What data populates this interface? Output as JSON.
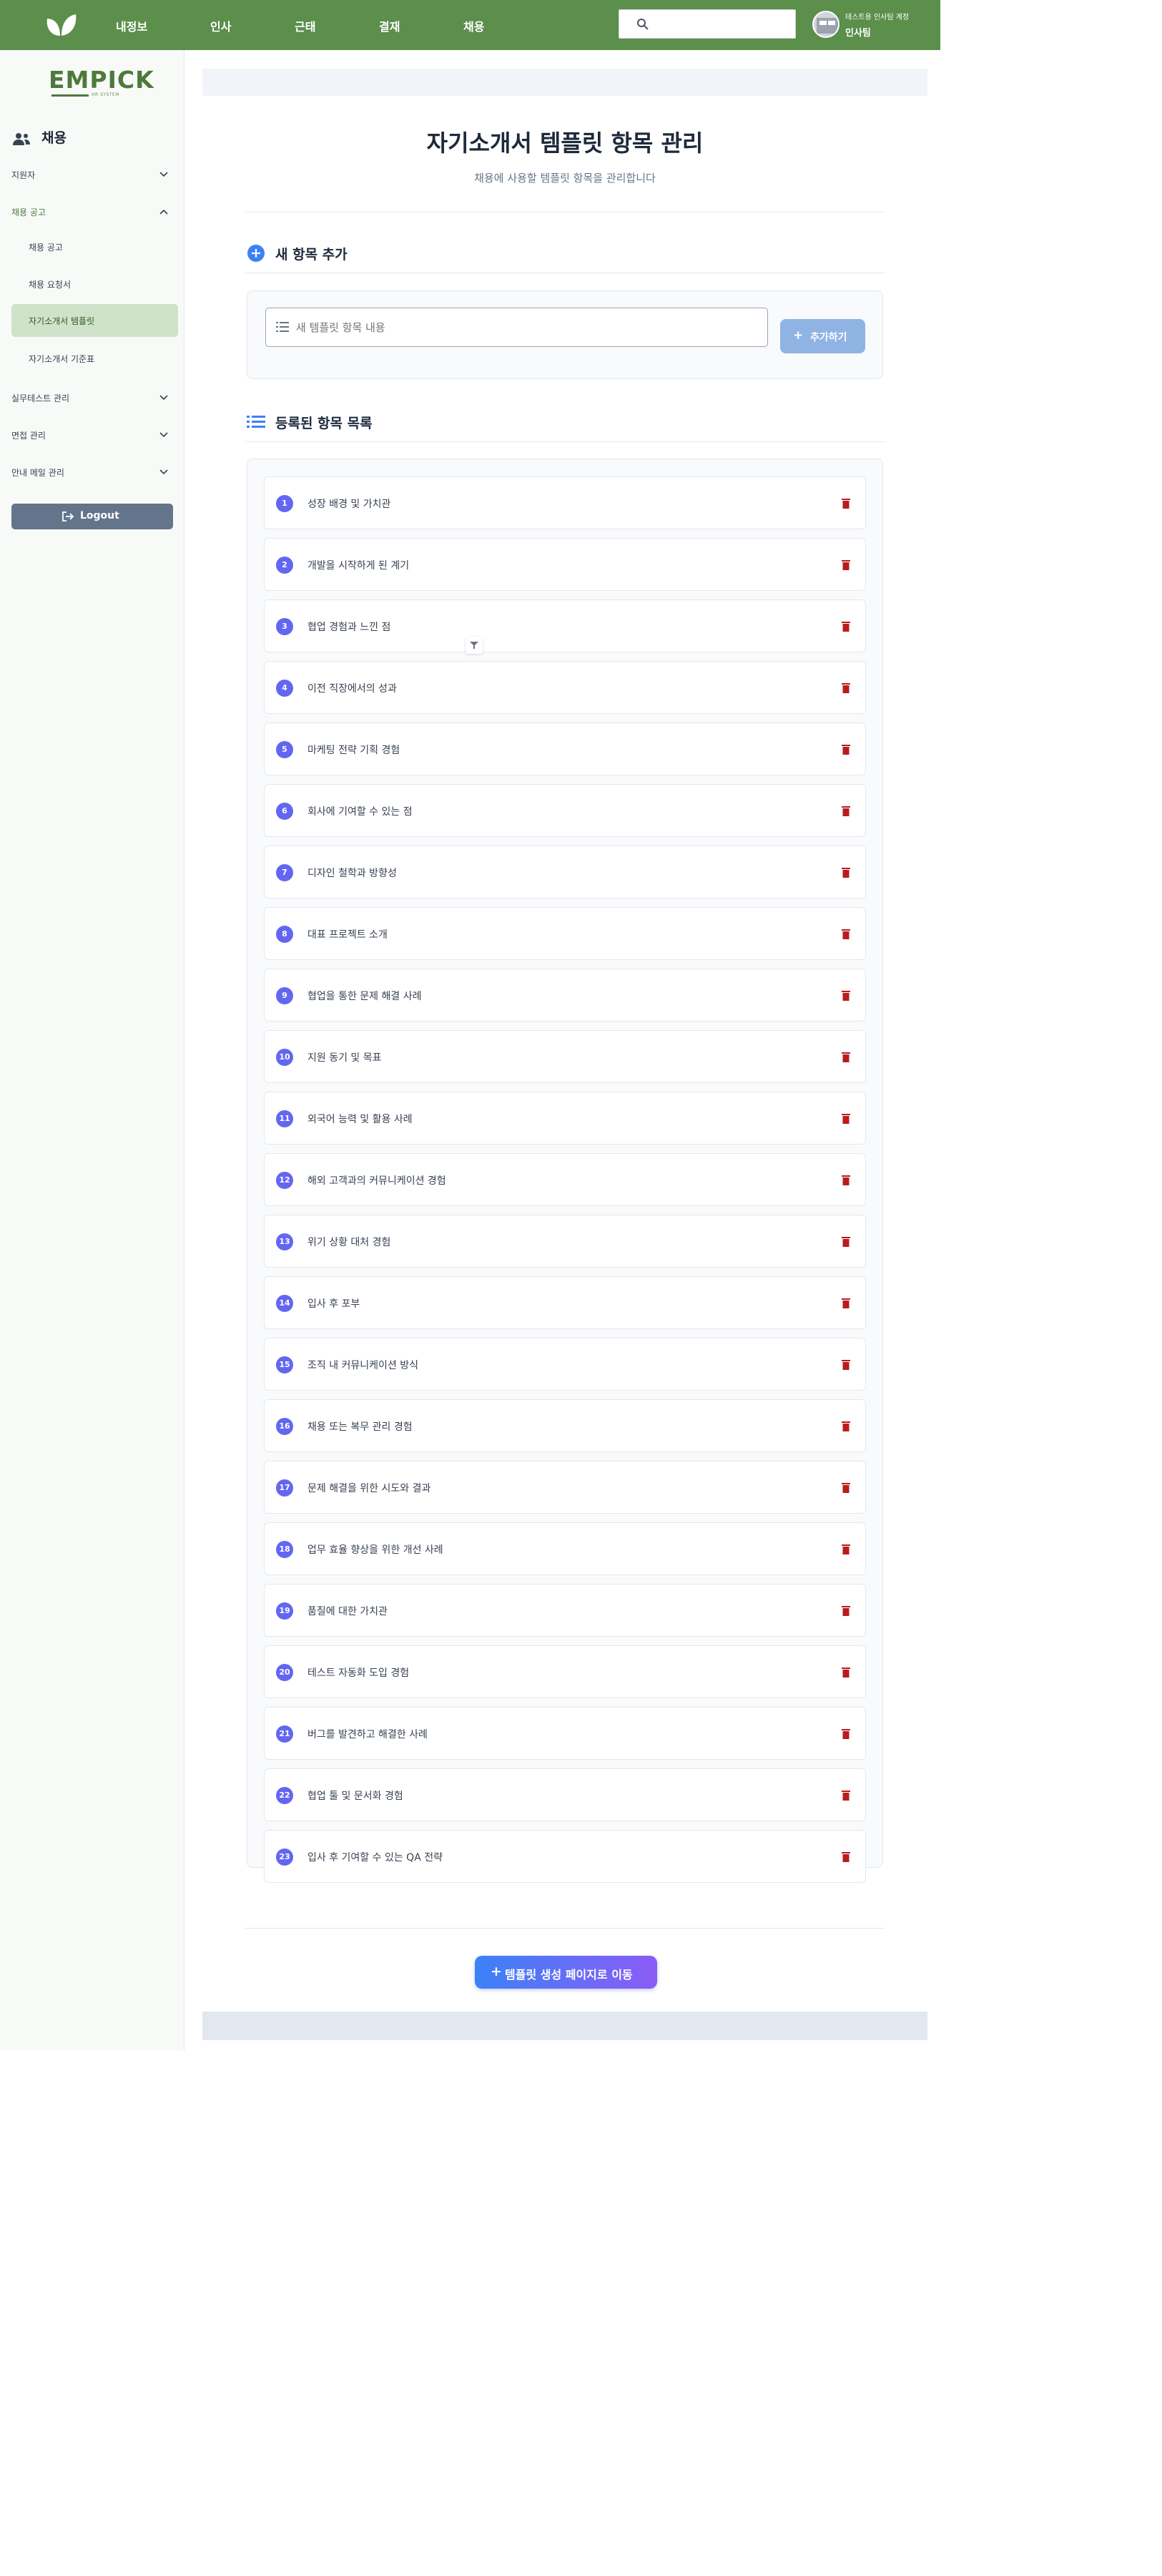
{
  "topnav": {
    "items": [
      "내정보",
      "인사",
      "근태",
      "결재",
      "채용"
    ],
    "user_account": "테스트용 인사팀 계정",
    "user_team": "인사팀"
  },
  "sidebar": {
    "brand": "EMPICK",
    "brand_sub": "HR SYSTEM",
    "section_title": "채용",
    "items": [
      {
        "label": "지원자",
        "expanded": false
      },
      {
        "label": "채용 공고",
        "expanded": true
      },
      {
        "label": "실무테스트 관리",
        "expanded": false
      },
      {
        "label": "면접 관리",
        "expanded": false
      },
      {
        "label": "안내 메일 관리",
        "expanded": false
      }
    ],
    "subitems": [
      "채용 공고",
      "채용 요청서",
      "자기소개서 템플릿",
      "자기소개서 기준표"
    ],
    "selected_subitem": "자기소개서 템플릿",
    "logout_label": "Logout"
  },
  "main": {
    "title": "자기소개서 템플릿 항목 관리",
    "subtitle": "채용에 사용할 템플릿 항목을 관리합니다",
    "add_section_title": "새 항목 추가",
    "add_placeholder": "새 템플릿 항목 내용",
    "add_button": "추가하기",
    "list_section_title": "등록된 항목 목록",
    "items": [
      "성장 배경 및 가치관",
      "개발을 시작하게 된 계기",
      "협업 경험과 느낀 점",
      "이전 직장에서의 성과",
      "마케팅 전략 기획 경험",
      "회사에 기여할 수 있는 점",
      "디자인 철학과 방향성",
      "대표 프로젝트 소개",
      "협업을 통한 문제 해결 사례",
      "지원 동기 및 목표",
      "외국어 능력 및 활용 사례",
      "해외 고객과의 커뮤니케이션 경험",
      "위기 상황 대처 경험",
      "입사 후 포부",
      "조직 내 커뮤니케이션 방식",
      "채용 또는 복무 관리 경험",
      "문제 해결을 위한 시도와 결과",
      "업무 효율 향상을 위한 개선 사례",
      "품질에 대한 가치관",
      "테스트 자동화 도입 경험",
      "버그를 발견하고 해결한 사례",
      "협업 툴 및 문서화 경험",
      "입사 후 기여할 수 있는 QA 전략"
    ],
    "go_button": "템플릿 생성 페이지로 이동"
  },
  "colors": {
    "topbar": "#5b8f4b",
    "brand": "#4d7a3b",
    "accent_blue": "#3b82f6",
    "badge": "#6366f1",
    "delete": "#b91c1c",
    "selected_bg": "#cfe3cb"
  }
}
